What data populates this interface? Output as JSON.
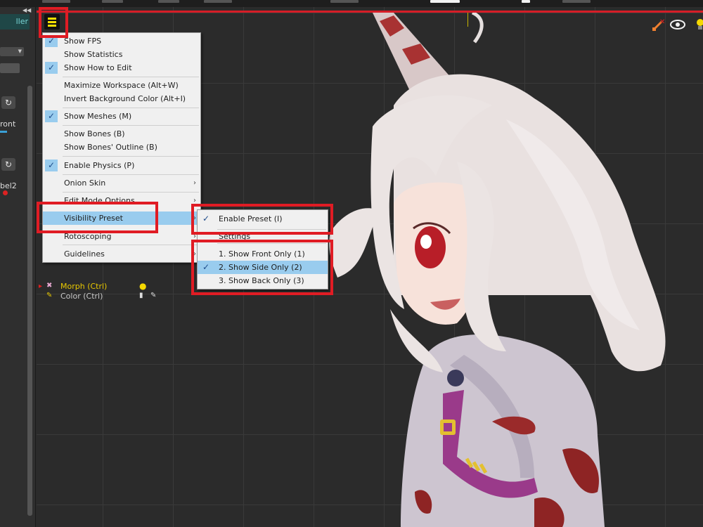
{
  "left_panel": {
    "tab_label": "ller",
    "collapse_glyph": "◀◀",
    "front_label": "ront",
    "label2": "bel2",
    "reset_glyph": "↻"
  },
  "menu": {
    "items": [
      {
        "label": "Show FPS",
        "checked": true
      },
      {
        "label": "Show Statistics",
        "checked": false
      },
      {
        "label": "Show How to Edit",
        "checked": true
      },
      {
        "label": "Maximize Workspace (Alt+W)",
        "checked": false
      },
      {
        "label": "Invert Background Color (Alt+I)",
        "checked": false
      },
      {
        "label": "Show Meshes (M)",
        "checked": true
      },
      {
        "label": "Show Bones (B)",
        "checked": false
      },
      {
        "label": "Show Bones' Outline (B)",
        "checked": false
      },
      {
        "label": "Enable Physics (P)",
        "checked": true
      },
      {
        "label": "Onion Skin",
        "checked": false,
        "submenu": true
      },
      {
        "label": "Edit Mode Options",
        "checked": false,
        "submenu": true
      },
      {
        "label": "Visibility Preset",
        "checked": false,
        "submenu": true,
        "highlighted": true
      },
      {
        "label": "Rotoscoping",
        "checked": false,
        "submenu": true
      },
      {
        "label": "Guidelines",
        "checked": false,
        "submenu": true
      }
    ],
    "check_glyph": "✓",
    "arrow_glyph": "›"
  },
  "submenu": {
    "enable_preset": "Enable Preset (I)",
    "settings": "Settings",
    "presets": [
      {
        "label": "1. Show Front Only (1)",
        "checked": false
      },
      {
        "label": "2. Show Side Only (2)",
        "checked": true
      },
      {
        "label": "3. Show Back Only (3)",
        "checked": false
      }
    ]
  },
  "layers": {
    "morph": "Morph (Ctrl)",
    "color": "Color (Ctrl)"
  },
  "colors": {
    "highlight": "#99ccee",
    "annotation_red": "#e01c24",
    "menu_icon_yellow": "#f5e000"
  }
}
